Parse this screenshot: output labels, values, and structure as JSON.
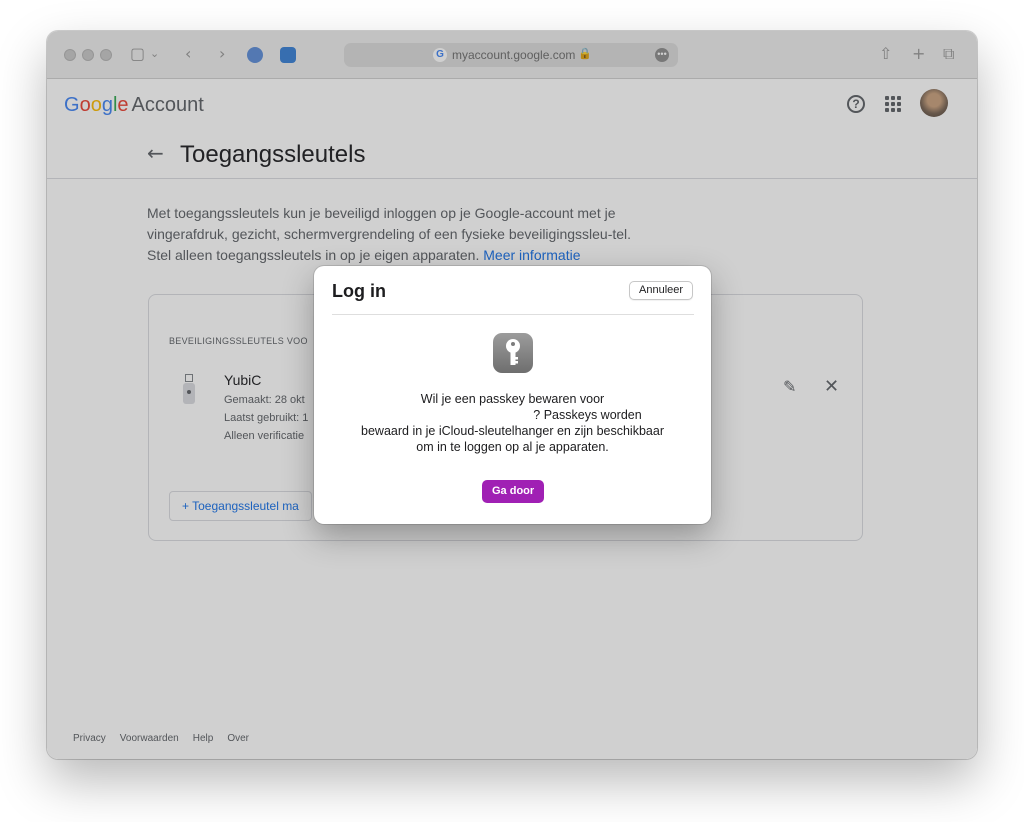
{
  "browser": {
    "url": "myaccount.google.com"
  },
  "header": {
    "brand_google": [
      "G",
      "o",
      "o",
      "g",
      "l",
      "e"
    ],
    "brand_account": "Account"
  },
  "page": {
    "title": "Toegangssleutels",
    "intro_text": "Met toegangssleutels kun je beveiligd inloggen op je Google-account met je vingerafdruk, gezicht, schermvergrendeling of een fysieke beveiligingssleu-tel. Stel alleen toegangssleutels in op je eigen apparaten.",
    "intro_link": "Meer informatie",
    "section_label": "Beveiligingssleutels voo",
    "key": {
      "name": "YubiC",
      "created": "Gemaakt: 28 okt",
      "last_used": "Laatst gebruikt: 1",
      "mode": "Alleen verificatie"
    },
    "add_button": "+  Toegangssleutel ma"
  },
  "footer": {
    "links": [
      "Privacy",
      "Voorwaarden",
      "Help",
      "Over"
    ]
  },
  "dialog": {
    "title": "Log in",
    "cancel_label": "Annuleer",
    "line1": "Wil je een passkey bewaren voor",
    "line2": "? Passkeys worden",
    "line3": "bewaard in je iCloud-sleutelhanger en zijn beschikbaar",
    "line4": "om in te loggen op al je apparaten.",
    "confirm_label": "Ga door"
  },
  "colors": {
    "confirm_accent": "#a020b4",
    "link_blue": "#1a73e8"
  },
  "icons": [
    "sidebar-icon",
    "back-icon",
    "forward-icon",
    "password-extension-icon",
    "dsm-extension-icon",
    "lock-icon",
    "share-icon",
    "new-tab-icon",
    "tab-overview-icon",
    "help-icon",
    "apps-icon",
    "pencil-icon",
    "close-icon",
    "key-icon"
  ]
}
